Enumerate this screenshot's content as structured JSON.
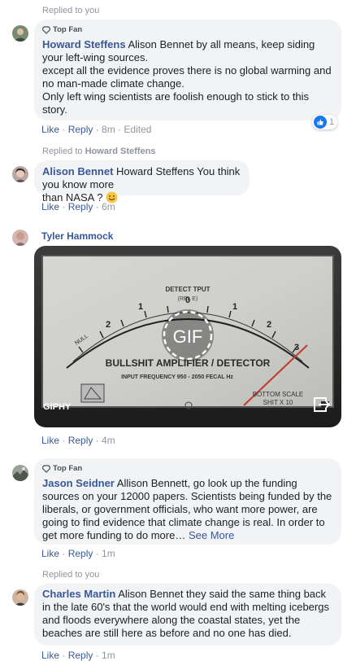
{
  "comments": [
    {
      "replied_prefix": "Replied to you",
      "badge": "Top Fan",
      "author": "Howard Steffens",
      "lines": [
        "Alison Bennet by all means, keep siding",
        "your left-wing sources.",
        "except all the evidence proves there is no global warming and",
        "no man-made climate change.",
        "Only left wing scientists are foolish enough to stick to this",
        "story."
      ],
      "actions": {
        "like": "Like",
        "reply": "Reply",
        "time": "8m",
        "edited": "Edited"
      },
      "reaction_count": "1"
    },
    {
      "replied_prefix": "Replied to",
      "replied_name": "Howard Steffens",
      "author": "Alison Bennet",
      "lines": [
        "Howard Steffens You think you know more",
        "than NASA ?"
      ],
      "emoji": "smile-emoji",
      "actions": {
        "like": "Like",
        "reply": "Reply",
        "time": "6m"
      }
    },
    {
      "author": "Tyler Hammock",
      "gif": {
        "meter_line1": "DETECT    TPUT",
        "meter_line2": "(REL    E)",
        "meter_title": "BULLSHIT AMPLIFIER / DETECTOR",
        "meter_sub": "INPUT FREQUENCY 950 - 2050 FECAL Hz",
        "meter_scale1": "BOTTOM SCALE",
        "meter_scale2": "SHIT X 10",
        "gif_label": "GIF",
        "source": "GIPHY"
      },
      "actions": {
        "like": "Like",
        "reply": "Reply",
        "time": "4m"
      }
    },
    {
      "badge": "Top Fan",
      "author": "Jason Seidner",
      "lines": [
        "Allison Bennett, go look up the funding",
        "sources on your 12000 papers. Scientists being funded by the",
        "liberals, or government officials, who want more power, are",
        "going to find evidence that climate change is real. In order to",
        "get more funding to do more…"
      ],
      "see_more": "See More",
      "actions": {
        "like": "Like",
        "reply": "Reply",
        "time": "1m"
      }
    },
    {
      "replied_prefix": "Replied to you",
      "author": "Charles Martin",
      "lines": [
        "Alison Bennet they said the same thing back",
        "in the late 60's that the world would end with melting icebergs",
        "and floods everywhere along the coastal states, yet the",
        "beaches are still here as before and no one has died."
      ],
      "actions": {
        "like": "Like",
        "reply": "Reply",
        "time": "1m"
      }
    }
  ],
  "colors": {
    "link": "#385898",
    "meta": "#90949c",
    "bubble": "#f2f3f5",
    "like_blue": "#1877f2"
  }
}
